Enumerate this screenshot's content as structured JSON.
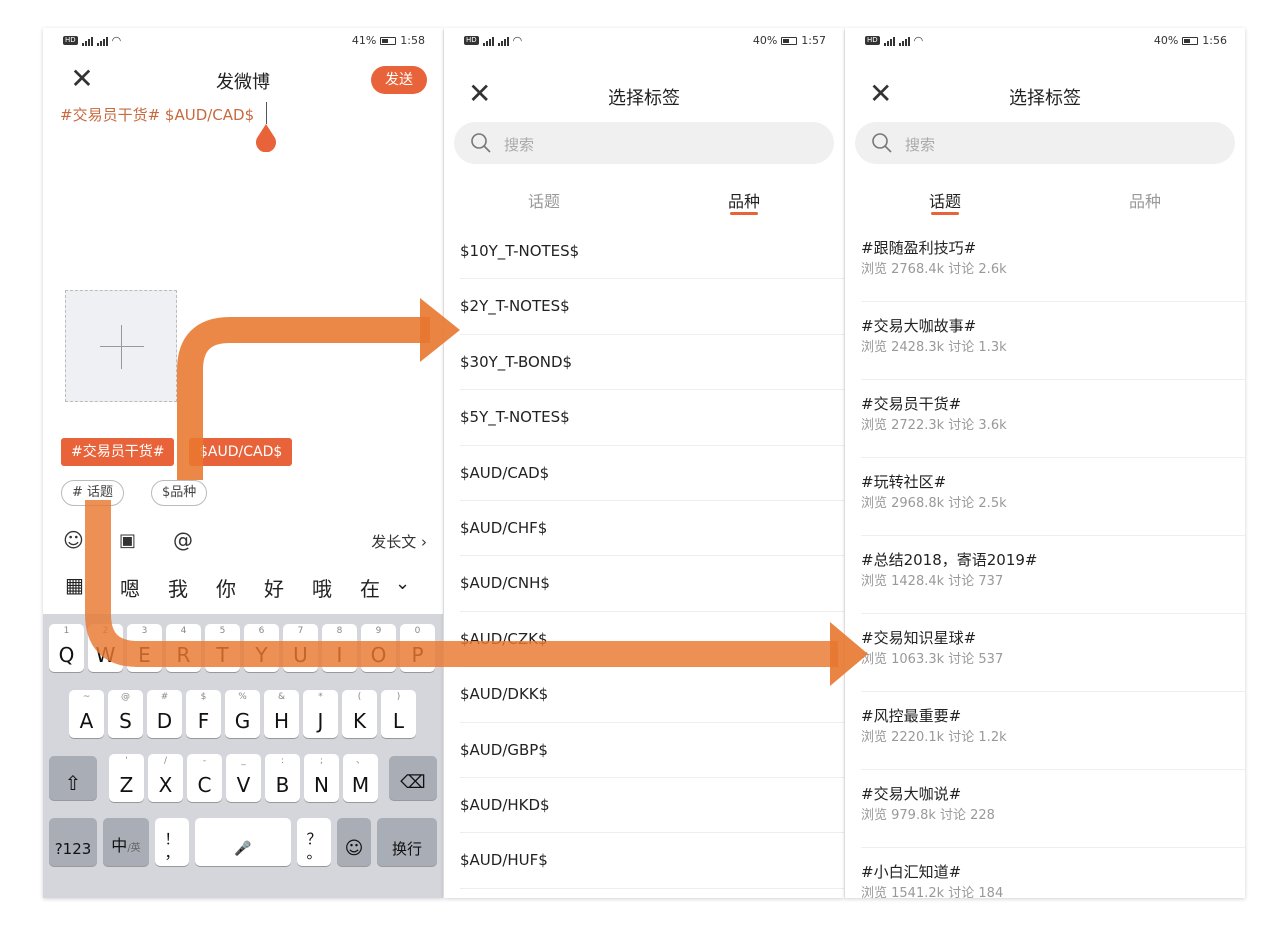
{
  "screens": {
    "compose": {
      "status": {
        "signal_left": "46",
        "battery_pct": "41%",
        "time": "1:58"
      },
      "title": "发微博",
      "send_label": "发送",
      "text": "#交易员干货# $AUD/CAD$",
      "chips": [
        "#交易员干货#",
        "$AUD/CAD$"
      ],
      "topic_pill": "# 话题",
      "instrument_pill": "$品种",
      "long_text_label": "发长文",
      "candidates": [
        "嗯",
        "我",
        "你",
        "好",
        "哦",
        "在"
      ],
      "keyboard": {
        "row1": [
          {
            "k": "Q",
            "s": "1"
          },
          {
            "k": "W",
            "s": "2"
          },
          {
            "k": "E",
            "s": "3"
          },
          {
            "k": "R",
            "s": "4"
          },
          {
            "k": "T",
            "s": "5"
          },
          {
            "k": "Y",
            "s": "6"
          },
          {
            "k": "U",
            "s": "7"
          },
          {
            "k": "I",
            "s": "8"
          },
          {
            "k": "O",
            "s": "9"
          },
          {
            "k": "P",
            "s": "0"
          }
        ],
        "row2": [
          {
            "k": "A",
            "s": "~"
          },
          {
            "k": "S",
            "s": "@"
          },
          {
            "k": "D",
            "s": "#"
          },
          {
            "k": "F",
            "s": "$"
          },
          {
            "k": "G",
            "s": "%"
          },
          {
            "k": "H",
            "s": "&"
          },
          {
            "k": "J",
            "s": "*"
          },
          {
            "k": "K",
            "s": "("
          },
          {
            "k": "L",
            "s": ")"
          }
        ],
        "row3": [
          {
            "k": "Z",
            "s": "'"
          },
          {
            "k": "X",
            "s": "/"
          },
          {
            "k": "C",
            "s": "-"
          },
          {
            "k": "V",
            "s": "_"
          },
          {
            "k": "B",
            "s": ":"
          },
          {
            "k": "N",
            "s": ";"
          },
          {
            "k": "M",
            "s": "、"
          }
        ],
        "num_key": "?123",
        "lang_key": "中",
        "lang_sub": "/英",
        "punct_key": "！\n，",
        "punct_key2": "？\n。",
        "enter_key": "换行"
      }
    },
    "instruments": {
      "status": {
        "battery_pct": "40%",
        "time": "1:57"
      },
      "title": "选择标签",
      "search_placeholder": "搜索",
      "tabs": [
        {
          "label": "话题",
          "active": false
        },
        {
          "label": "品种",
          "active": true
        }
      ],
      "items": [
        "$10Y_T-NOTES$",
        "$2Y_T-NOTES$",
        "$30Y_T-BOND$",
        "$5Y_T-NOTES$",
        "$AUD/CAD$",
        "$AUD/CHF$",
        "$AUD/CNH$",
        "$AUD/CZK$",
        "$AUD/DKK$",
        "$AUD/GBP$",
        "$AUD/HKD$",
        "$AUD/HUF$"
      ]
    },
    "topics": {
      "status": {
        "battery_pct": "40%",
        "time": "1:56"
      },
      "title": "选择标签",
      "search_placeholder": "搜索",
      "tabs": [
        {
          "label": "话题",
          "active": true
        },
        {
          "label": "品种",
          "active": false
        }
      ],
      "items": [
        {
          "name": "#跟随盈利技巧#",
          "stats": "浏览 2768.4k  讨论 2.6k"
        },
        {
          "name": "#交易大咖故事#",
          "stats": "浏览 2428.3k  讨论 1.3k"
        },
        {
          "name": "#交易员干货#",
          "stats": "浏览 2722.3k  讨论 3.6k"
        },
        {
          "name": "#玩转社区#",
          "stats": "浏览 2968.8k  讨论 2.5k"
        },
        {
          "name": "#总结2018，寄语2019#",
          "stats": "浏览 1428.4k  讨论 737"
        },
        {
          "name": "#交易知识星球#",
          "stats": "浏览 1063.3k  讨论 537"
        },
        {
          "name": "#风控最重要#",
          "stats": "浏览 2220.1k  讨论 1.2k"
        },
        {
          "name": "#交易大咖说#",
          "stats": "浏览 979.8k  讨论 228"
        },
        {
          "name": "#小白汇知道#",
          "stats": "浏览 1541.2k  讨论 184"
        }
      ]
    }
  },
  "colors": {
    "accent": "#e8633a",
    "arrow": "#e8772f"
  }
}
